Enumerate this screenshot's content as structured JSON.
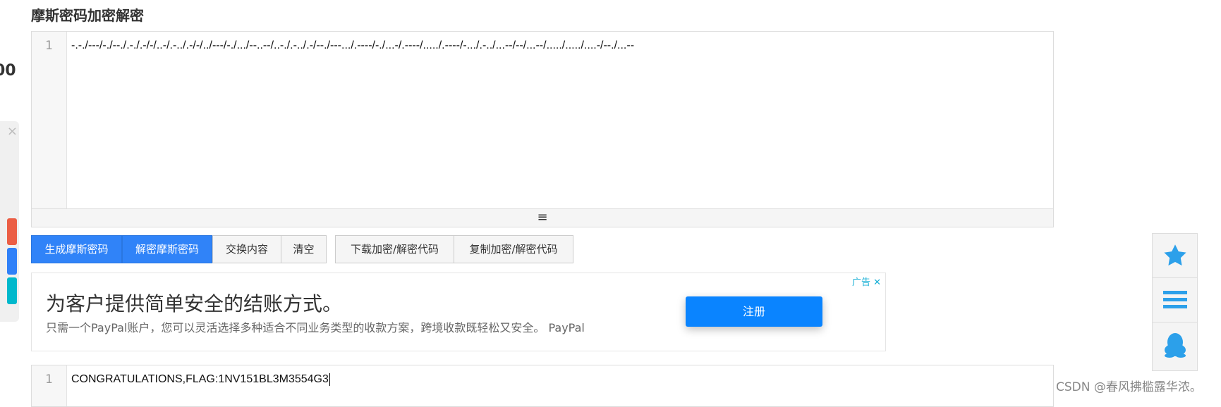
{
  "title": "摩斯密码加密解密",
  "input": {
    "line": "1",
    "text": "-.-./---/-./--./.-./.-/-/..-/.-../.-/-/../---/-./.../--..--/..-./.-../.-/--./---.../.----/-./...-/.----/...../.----/-.../.-../...--/--/...--/...../...../....-/--./...--"
  },
  "resize_handle": "≡",
  "buttons": [
    "生成摩斯密码",
    "解密摩斯密码",
    "交换内容",
    "清空",
    "下载加密/解密代码",
    "复制加密/解密代码"
  ],
  "ad": {
    "headline": "为客户提供简单安全的结账方式。",
    "sub": "只需一个PayPal账户，您可以灵活选择多种适合不同业务类型的收款方案，跨境收款既轻松又安全。 PayPal",
    "button": "注册",
    "tag": "广告 ✕"
  },
  "output": {
    "line": "1",
    "text": "CONGRATULATIONS,FLAG:1NV151BL3M3554G3"
  },
  "left_partial": {
    "text": "00",
    "close": "×"
  },
  "watermark": "CSDN @春风拂槛露华浓。",
  "colors": {
    "accent": "#3083f8",
    "side_icon": "#2ca0ea"
  }
}
